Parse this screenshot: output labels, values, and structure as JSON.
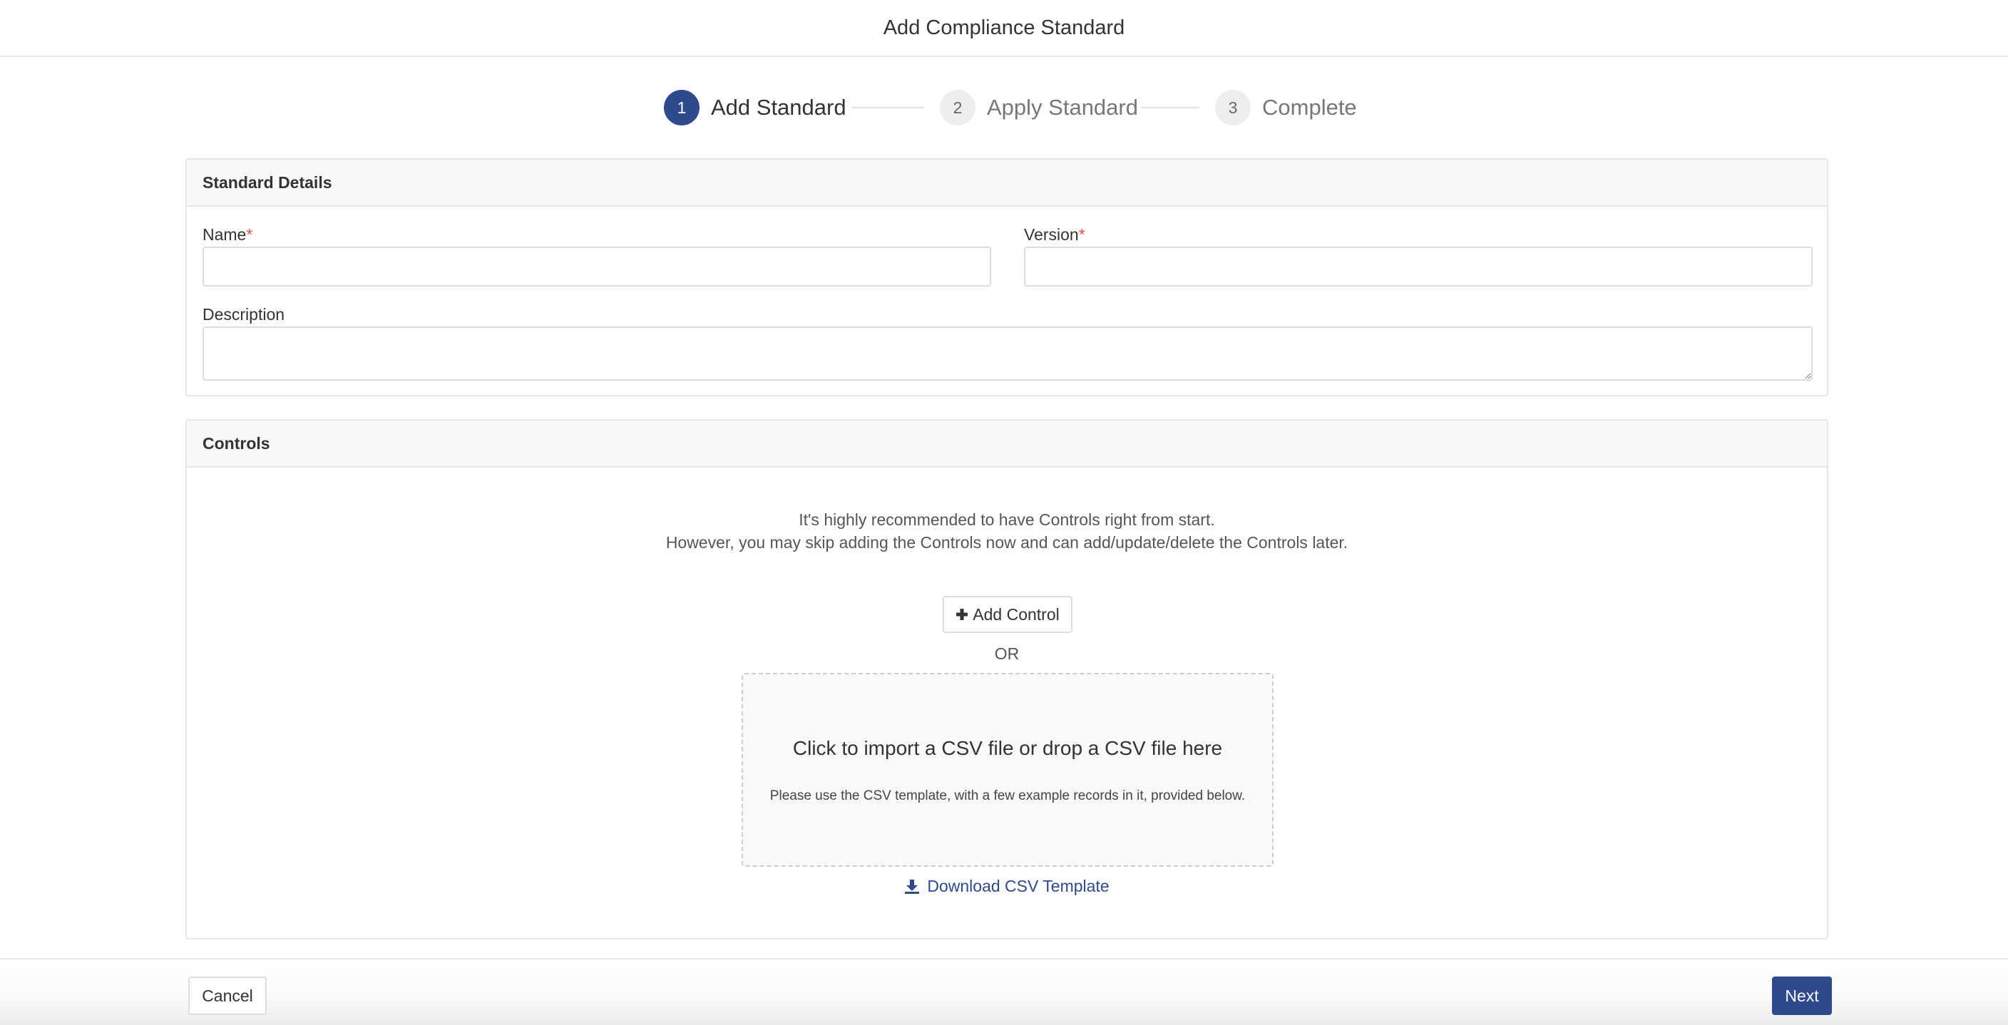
{
  "header": {
    "title": "Add Compliance Standard"
  },
  "stepper": {
    "steps": [
      {
        "number": "1",
        "label": "Add Standard",
        "state": "active"
      },
      {
        "number": "2",
        "label": "Apply Standard",
        "state": "inactive"
      },
      {
        "number": "3",
        "label": "Complete",
        "state": "inactive"
      }
    ]
  },
  "standard_details": {
    "title": "Standard Details",
    "name_label": "Name",
    "version_label": "Version",
    "description_label": "Description",
    "required_marker": "*",
    "name_value": "",
    "version_value": "",
    "description_value": ""
  },
  "controls": {
    "title": "Controls",
    "info_line1": "It's highly recommended to have Controls right from start.",
    "info_line2": "However, you may skip adding the Controls now and can add/update/delete the Controls later.",
    "add_control_label": "Add Control",
    "or_text": "OR",
    "dropzone_title": "Click to import a CSV file or drop a CSV file here",
    "dropzone_subtitle": "Please use the CSV template, with a few example records in it, provided below.",
    "download_label": "Download CSV Template"
  },
  "footer": {
    "cancel_label": "Cancel",
    "next_label": "Next"
  },
  "colors": {
    "primary": "#2e4a8c",
    "required": "#d9534f",
    "border": "#dddddd",
    "panel_header_bg": "#f8f8f8"
  },
  "icons": {
    "add_control": "plus-icon",
    "download": "download-icon"
  }
}
